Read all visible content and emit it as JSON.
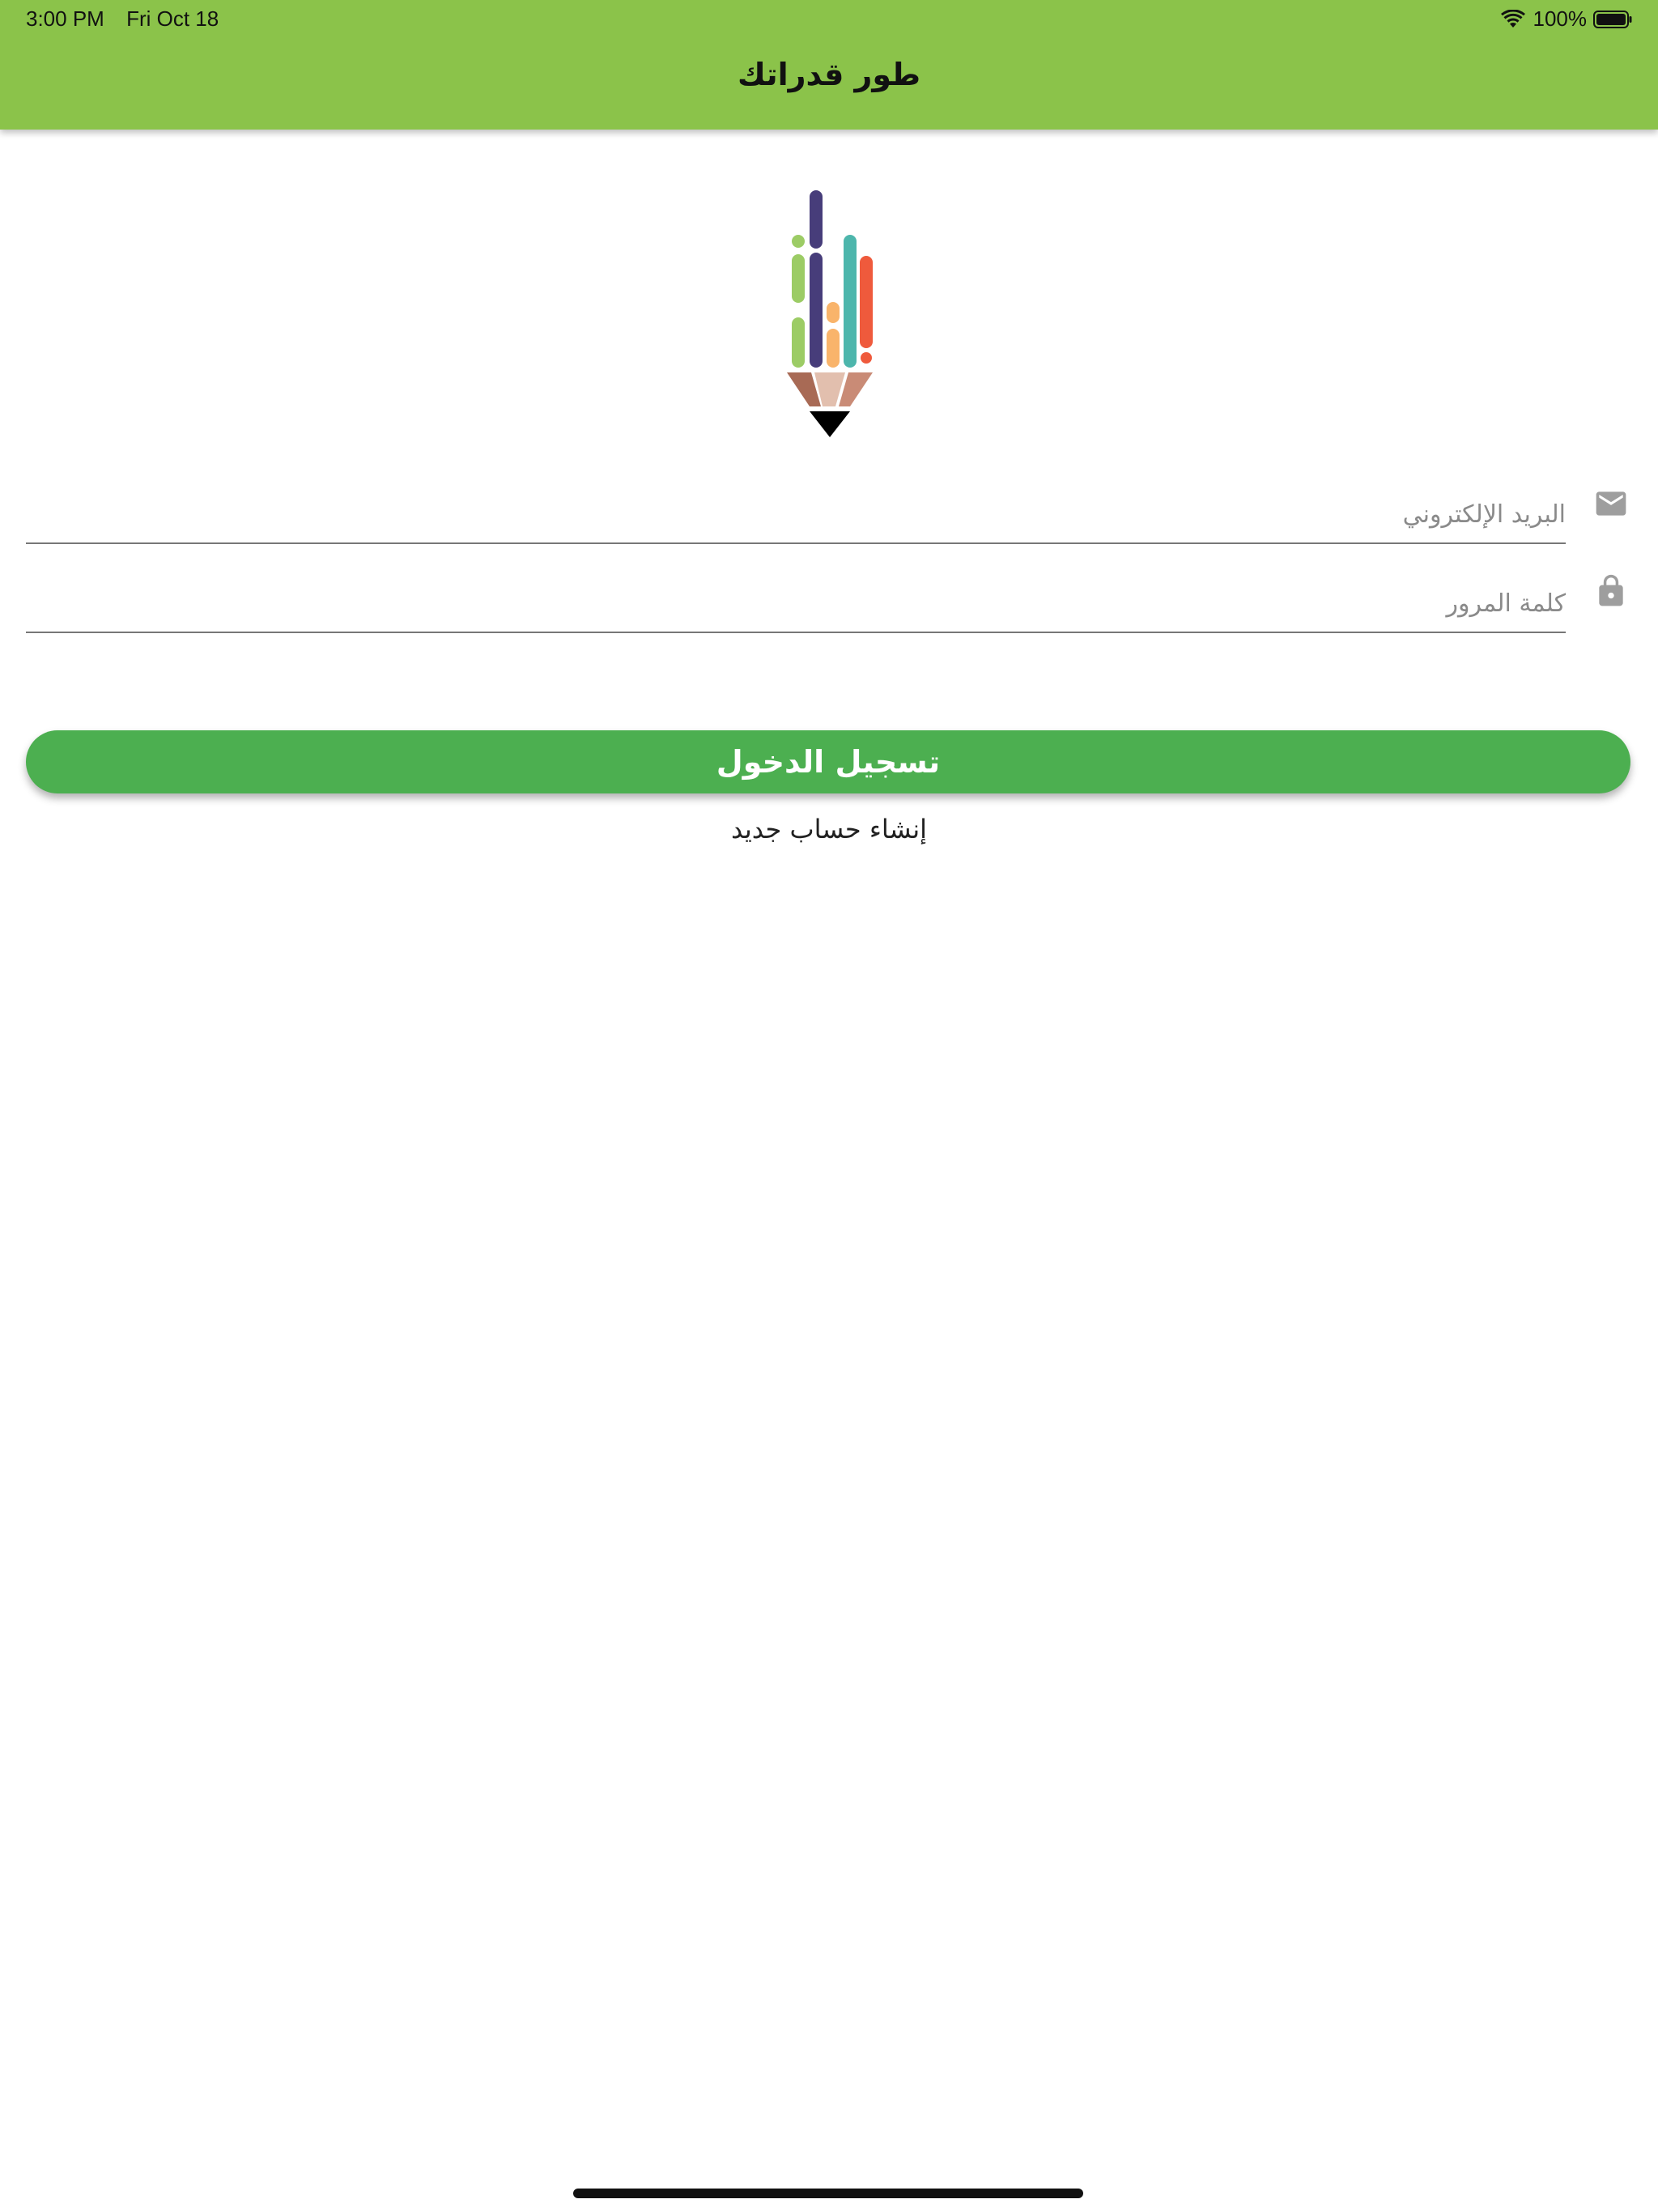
{
  "status_bar": {
    "time": "3:00 PM",
    "date": "Fri Oct 18",
    "battery": "100%",
    "wifi_icon": "wifi-icon",
    "battery_icon": "battery-icon"
  },
  "app_bar": {
    "title": "طور قدراتك"
  },
  "logo": {
    "icon": "pencil-bars-logo",
    "colors": [
      "#9ccc65",
      "#473d7a",
      "#f9b46b",
      "#4db6ac",
      "#ef5a3c",
      "#a86a55",
      "#e2bfae",
      "#c98b76",
      "#000000"
    ]
  },
  "form": {
    "email": {
      "placeholder": "البريد الإلكتروني",
      "value": "",
      "icon": "mail-icon"
    },
    "password": {
      "placeholder": "كلمة المرور",
      "value": "",
      "icon": "lock-icon"
    }
  },
  "actions": {
    "login_label": "تسجيل الدخول",
    "register_label": "إنشاء حساب جديد"
  },
  "colors": {
    "app_bar": "#8bc34a",
    "login_button": "#4caf50",
    "icon_gray": "#9e9e9e"
  }
}
